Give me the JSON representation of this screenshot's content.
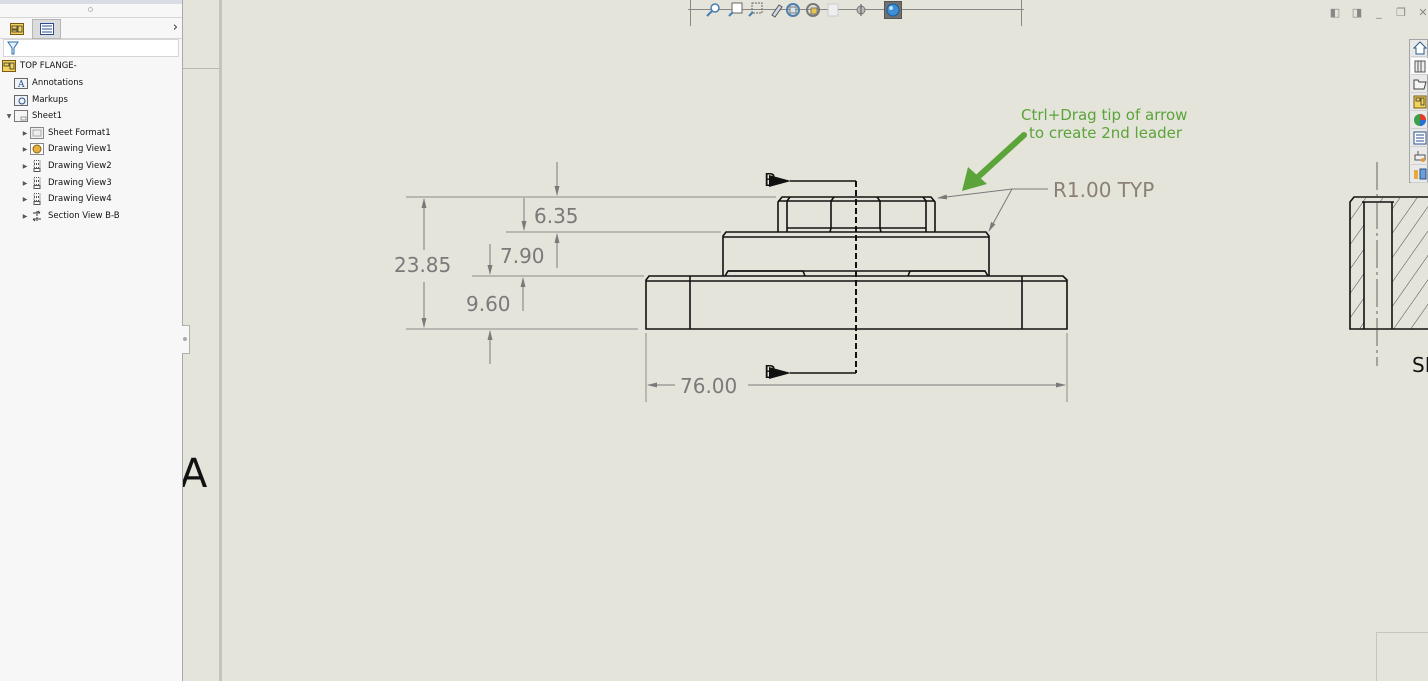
{
  "feature_manager": {
    "tabs": [
      {
        "name": "feature-manager-tab",
        "icon": "drawing-feature-icon"
      },
      {
        "name": "property-manager-tab",
        "icon": "property-list-icon"
      }
    ],
    "expand_glyph": "›",
    "filter_placeholder": "",
    "tree": [
      {
        "label": "TOP FLANGE-",
        "icon": "drawing-doc-icon",
        "level": 0,
        "expander": ""
      },
      {
        "label": "Annotations",
        "icon": "annotations-folder-icon",
        "level": 1,
        "expander": ""
      },
      {
        "label": "Markups",
        "icon": "markups-folder-icon",
        "level": 1,
        "expander": ""
      },
      {
        "label": "Sheet1",
        "icon": "sheet-icon",
        "level": 1,
        "expander": "▼"
      },
      {
        "label": "Sheet Format1",
        "icon": "sheet-format-icon",
        "level": 2,
        "expander": "▶"
      },
      {
        "label": "Drawing View1",
        "icon": "drawing-view-model-icon",
        "level": 2,
        "expander": "▶"
      },
      {
        "label": "Drawing View2",
        "icon": "drawing-view-icon",
        "level": 2,
        "expander": "▶"
      },
      {
        "label": "Drawing View3",
        "icon": "drawing-view-icon",
        "level": 2,
        "expander": "▶"
      },
      {
        "label": "Drawing View4",
        "icon": "drawing-view-icon",
        "level": 2,
        "expander": "▶"
      },
      {
        "label": "Section View B-B",
        "icon": "section-view-icon",
        "level": 2,
        "expander": "▶"
      }
    ]
  },
  "sheet": {
    "zone_letter": "A"
  },
  "hud_toolbar": {
    "icons": [
      "zoom-to-fit-icon",
      "zoom-to-area-icon",
      "zoom-to-selection-icon",
      "sketch-pen-icon",
      "rotate-view-icon",
      "view-orientation-icon",
      "hide-show-icon",
      "section-icon",
      "appearance-icon",
      "scene-icon"
    ]
  },
  "window_controls": [
    "tile-left",
    "tile-right",
    "minimize",
    "restore",
    "close"
  ],
  "window_glyphs": {
    "tile_left": "◧",
    "tile_right": "◨",
    "minimize": "_",
    "restore": "❐",
    "close": "✕"
  },
  "task_pane": [
    "solidworks-resources-icon",
    "design-library-icon",
    "file-explorer-icon",
    "view-palette-icon",
    "appearances-icon",
    "custom-properties-icon",
    "solidworks-forum-icon",
    "3d-interconnect-icon"
  ],
  "drawing": {
    "dimensions": {
      "overall_height": "23.85",
      "top_boss_height": "6.35",
      "mid_step_height": "7.90",
      "base_height": "9.60",
      "overall_width": "76.00"
    },
    "radius_note": "R1.00 TYP",
    "section_label_top": "B",
    "section_label_bottom": "B",
    "callout_line1": "Ctrl+Drag tip of arrow",
    "callout_line2": "to create 2nd leader",
    "section_view_label_partial": "SE",
    "colors": {
      "callout_green": "#5aa43a",
      "dimension_gray": "#7a7a7a",
      "note_brown": "#8a8077",
      "geometry": "#111111",
      "sheet_bg": "#e5e4da"
    }
  }
}
